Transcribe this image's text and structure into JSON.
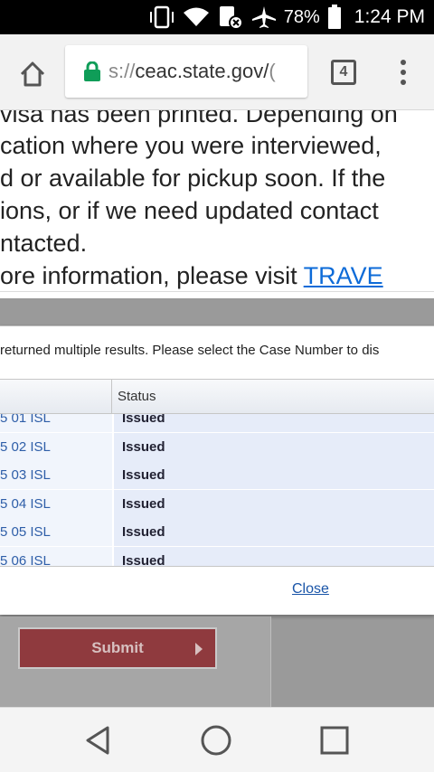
{
  "status_bar": {
    "battery_percent": "78%",
    "time": "1:24 PM"
  },
  "browser": {
    "url_prefix": "s://",
    "url_host": "ceac.state.gov/",
    "url_tail": "(",
    "tab_count": "4"
  },
  "page": {
    "lines": [
      "visa has been printed. Depending on",
      "cation where you were interviewed,",
      "d or available for pickup soon. If the",
      "ions, or if we need updated contact",
      "ntacted."
    ],
    "info_prefix": "ore information, please visit ",
    "info_link": "TRAVE"
  },
  "modal": {
    "message": "returned multiple results. Please select the Case Number to dis",
    "columns": [
      "",
      "Status"
    ],
    "rows": [
      {
        "case": "5 01 ISL",
        "status": "Issued"
      },
      {
        "case": "5 02 ISL",
        "status": "Issued"
      },
      {
        "case": "5 03 ISL",
        "status": "Issued"
      },
      {
        "case": "5 04 ISL",
        "status": "Issued"
      },
      {
        "case": "5 05 ISL",
        "status": "Issued"
      },
      {
        "case": "5 06 ISL",
        "status": "Issued"
      }
    ],
    "close_label": "Close"
  },
  "form": {
    "submit_label": "Submit"
  },
  "colors": {
    "link": "#0d6bd8",
    "lock": "#0f9d58",
    "submit_bg": "#8f3a3e"
  }
}
